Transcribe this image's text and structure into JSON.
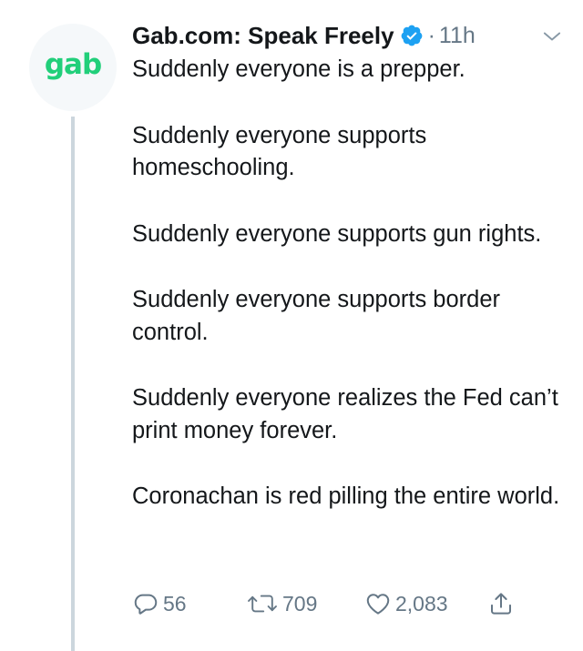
{
  "avatar": {
    "text": "gab",
    "color": "#21cf7a"
  },
  "header": {
    "display_name": "Gab.com: Speak Freely",
    "separator": "·",
    "time": "11h",
    "verified_icon": "verified-badge-icon",
    "caret_icon": "chevron-down-icon"
  },
  "tweet": {
    "paragraphs": [
      "Suddenly everyone is a prepper.",
      "Suddenly everyone supports homeschooling.",
      "Suddenly everyone supports gun rights.",
      "Suddenly everyone supports border control.",
      "Suddenly everyone realizes the Fed can’t print money forever.",
      "Coronachan is red pilling the entire world."
    ]
  },
  "actions": {
    "replies": "56",
    "retweets": "709",
    "likes": "2,083"
  },
  "colors": {
    "text": "#14171a",
    "muted": "#657786",
    "verified": "#1da1f2",
    "brand": "#21cf7a",
    "thread_line": "#ccd6dd"
  }
}
